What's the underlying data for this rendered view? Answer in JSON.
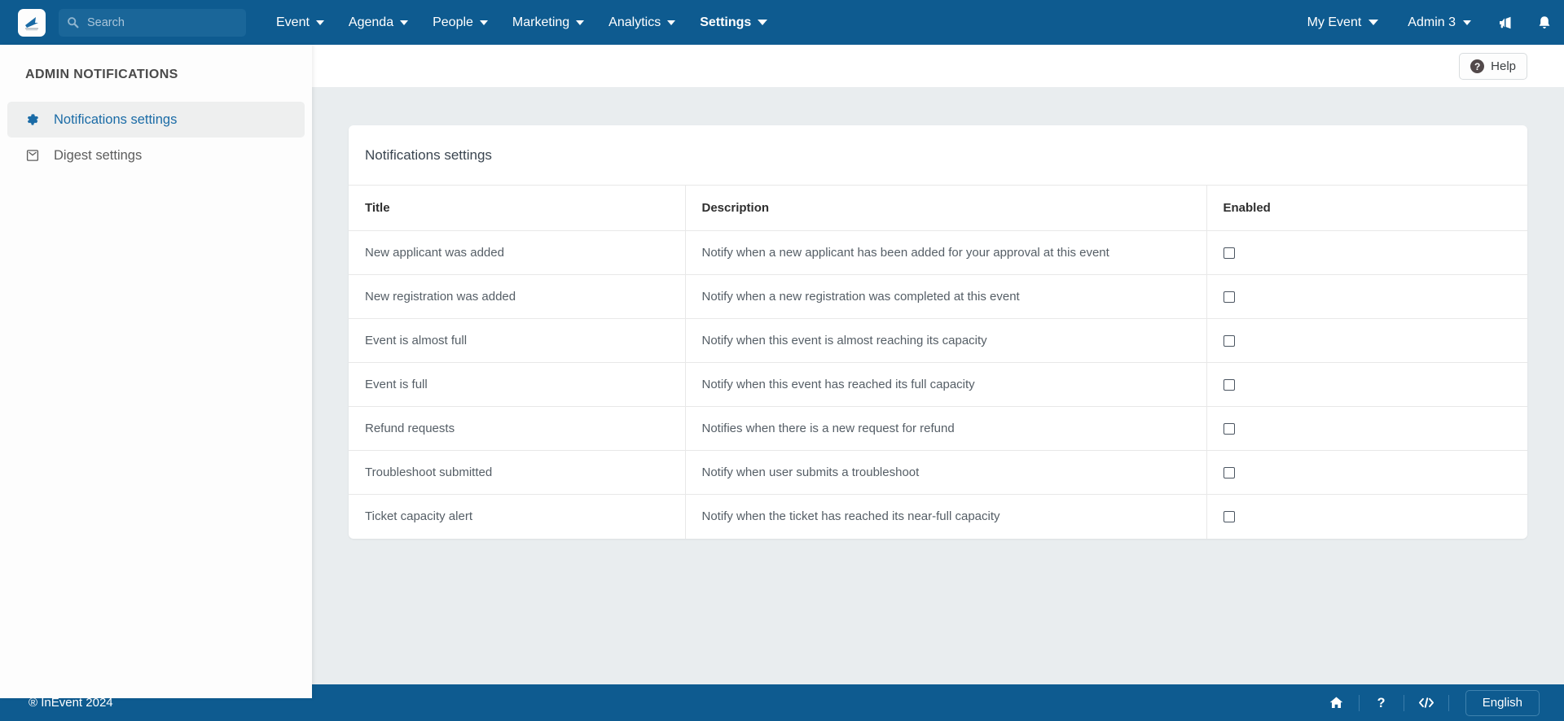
{
  "colors": {
    "brand_blue": "#0e5b90",
    "search_bg": "#1a6699",
    "content_bg": "#e9edef",
    "sidebar_active_bg": "#eeefef",
    "sidebar_active_text": "#1a6ba6"
  },
  "topbar": {
    "logo": "inevent-logo-icon",
    "search": {
      "placeholder": "Search",
      "value": "",
      "icon": "search-icon"
    },
    "nav": [
      {
        "label": "Event",
        "active": false
      },
      {
        "label": "Agenda",
        "active": false
      },
      {
        "label": "People",
        "active": false
      },
      {
        "label": "Marketing",
        "active": false
      },
      {
        "label": "Analytics",
        "active": false
      },
      {
        "label": "Settings",
        "active": true
      }
    ],
    "right": {
      "event_menu": "My Event",
      "admin_menu": "Admin 3",
      "announcement_icon": "megaphone-icon",
      "notification_icon": "bell-icon"
    }
  },
  "sidebar": {
    "title": "ADMIN NOTIFICATIONS",
    "items": [
      {
        "label": "Notifications settings",
        "icon": "gear-icon",
        "active": true
      },
      {
        "label": "Digest settings",
        "icon": "inbox-envelope-icon",
        "active": false
      }
    ]
  },
  "content": {
    "help_button": {
      "label": "Help",
      "icon": "question-circle-icon"
    },
    "card_title": "Notifications settings",
    "table": {
      "columns": [
        "Title",
        "Description",
        "Enabled"
      ],
      "rows": [
        {
          "title": "New applicant was added",
          "description": "Notify when a new applicant has been added for your approval at this event",
          "enabled": false
        },
        {
          "title": "New registration was added",
          "description": "Notify when a new registration was completed at this event",
          "enabled": false
        },
        {
          "title": "Event is almost full",
          "description": "Notify when this event is almost reaching its capacity",
          "enabled": false
        },
        {
          "title": "Event is full",
          "description": "Notify when this event has reached its full capacity",
          "enabled": false
        },
        {
          "title": "Refund requests",
          "description": "Notifies when there is a new request for refund",
          "enabled": false
        },
        {
          "title": "Troubleshoot submitted",
          "description": "Notify when user submits a troubleshoot",
          "enabled": false
        },
        {
          "title": "Ticket capacity alert",
          "description": "Notify when the ticket has reached its near-full capacity",
          "enabled": false
        }
      ]
    }
  },
  "footer": {
    "copyright": "® InEvent 2024",
    "icons": [
      "home-icon",
      "question-mark-icon",
      "code-brackets-icon"
    ],
    "language": "English"
  }
}
